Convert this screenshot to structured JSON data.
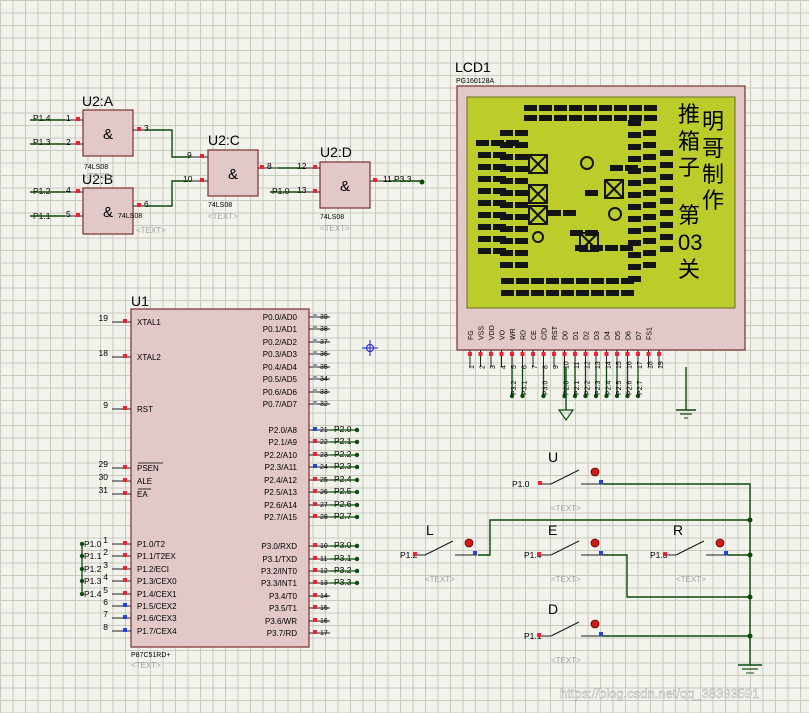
{
  "gate_symbol": "&",
  "gate_part": "74LS08",
  "text_placeholder": "<TEXT>",
  "u2a": {
    "ref": "U2:A",
    "in1_pin": "1",
    "in2_pin": "2",
    "out_pin": "3",
    "in1_net": "P1.4",
    "in2_net": "P1.3"
  },
  "u2b": {
    "ref": "U2:B",
    "in1_pin": "4",
    "in2_pin": "5",
    "out_pin": "6",
    "in1_net": "P1.2",
    "in2_net": "P1.1"
  },
  "u2c": {
    "ref": "U2:C",
    "in1_pin": "9",
    "in2_pin": "10",
    "out_pin": "8"
  },
  "u2d": {
    "ref": "U2:D",
    "in1_pin": "12",
    "in2_pin": "13",
    "out_pin": "11",
    "in2_net": "P1.0",
    "out_net": "P3.3"
  },
  "lcd": {
    "ref": "LCD1",
    "part": "PG160128A",
    "chars": [
      "推",
      "箱",
      "子",
      "明",
      "哥",
      "制",
      "作",
      "第",
      "03",
      "关"
    ],
    "pin_names": [
      "FG",
      "VSS",
      "VDD",
      "VO",
      "WR",
      "RD",
      "CE",
      "C/D",
      "RST",
      "D0",
      "D1",
      "D2",
      "D3",
      "D4",
      "D5",
      "D6",
      "D7",
      "FS1"
    ],
    "pin_numbers": [
      "1",
      "2",
      "3",
      "4",
      "5",
      "6",
      "7",
      "8",
      "9",
      "10",
      "11",
      "12",
      "13",
      "14",
      "15",
      "16",
      "17",
      "18",
      "19"
    ],
    "net_labels": [
      "P3.2",
      "P3.1",
      "P3.0",
      "P2.0",
      "P2.1",
      "P2.2",
      "P2.3",
      "P2.4",
      "P2.5",
      "P2.6",
      "P2.7"
    ]
  },
  "u1": {
    "ref": "U1",
    "part": "P87C51RD+",
    "left_pins": [
      {
        "num": "19",
        "name": "XTAL1"
      },
      {
        "num": "18",
        "name": "XTAL2"
      },
      {
        "num": "9",
        "name": "RST"
      },
      {
        "num": "29",
        "name": "PSEN"
      },
      {
        "num": "30",
        "name": "ALE"
      },
      {
        "num": "31",
        "name": "EA"
      },
      {
        "num": "1",
        "name": "P1.0/T2",
        "net": "P1.0"
      },
      {
        "num": "2",
        "name": "P1.1/T2EX",
        "net": "P1.1"
      },
      {
        "num": "3",
        "name": "P1.2/ECI",
        "net": "P1.2"
      },
      {
        "num": "4",
        "name": "P1.3/CEX0",
        "net": "P1.3"
      },
      {
        "num": "5",
        "name": "P1.4/CEX1",
        "net": "P1.4"
      },
      {
        "num": "6",
        "name": "P1.5/CEX2"
      },
      {
        "num": "7",
        "name": "P1.6/CEX3"
      },
      {
        "num": "8",
        "name": "P1.7/CEX4"
      }
    ],
    "right_pins": [
      {
        "num": "39",
        "name": "P0.0/AD0"
      },
      {
        "num": "38",
        "name": "P0.1/AD1"
      },
      {
        "num": "37",
        "name": "P0.2/AD2"
      },
      {
        "num": "36",
        "name": "P0.3/AD3"
      },
      {
        "num": "35",
        "name": "P0.4/AD4"
      },
      {
        "num": "34",
        "name": "P0.5/AD5"
      },
      {
        "num": "33",
        "name": "P0.6/AD6"
      },
      {
        "num": "32",
        "name": "P0.7/AD7"
      },
      {
        "num": "21",
        "name": "P2.0/A8",
        "net": "P2.0"
      },
      {
        "num": "22",
        "name": "P2.1/A9",
        "net": "P2.1"
      },
      {
        "num": "23",
        "name": "P2.2/A10",
        "net": "P2.2"
      },
      {
        "num": "24",
        "name": "P2.3/A11",
        "net": "P2.3"
      },
      {
        "num": "25",
        "name": "P2.4/A12",
        "net": "P2.4"
      },
      {
        "num": "26",
        "name": "P2.5/A13",
        "net": "P2.5"
      },
      {
        "num": "27",
        "name": "P2.6/A14",
        "net": "P2.6"
      },
      {
        "num": "28",
        "name": "P2.7/A15",
        "net": "P2.7"
      },
      {
        "num": "10",
        "name": "P3.0/RXD",
        "net": "P3.0"
      },
      {
        "num": "11",
        "name": "P3.1/TXD",
        "net": "P3.1"
      },
      {
        "num": "12",
        "name": "P3.2/INT0",
        "net": "P3.2"
      },
      {
        "num": "13",
        "name": "P3.3/INT1",
        "net": "P3.3"
      },
      {
        "num": "14",
        "name": "P3.4/T0"
      },
      {
        "num": "15",
        "name": "P3.5/T1"
      },
      {
        "num": "16",
        "name": "P3.6/WR"
      },
      {
        "num": "17",
        "name": "P3.7/RD"
      }
    ]
  },
  "switches": [
    {
      "ref": "U",
      "net": "P1.0"
    },
    {
      "ref": "L",
      "net": "P1.2"
    },
    {
      "ref": "E",
      "net": "P1.4"
    },
    {
      "ref": "R",
      "net": "P1.3"
    },
    {
      "ref": "D",
      "net": "P1.1"
    }
  ],
  "watermark": "https://blog.csdn.net/qq_38393591"
}
